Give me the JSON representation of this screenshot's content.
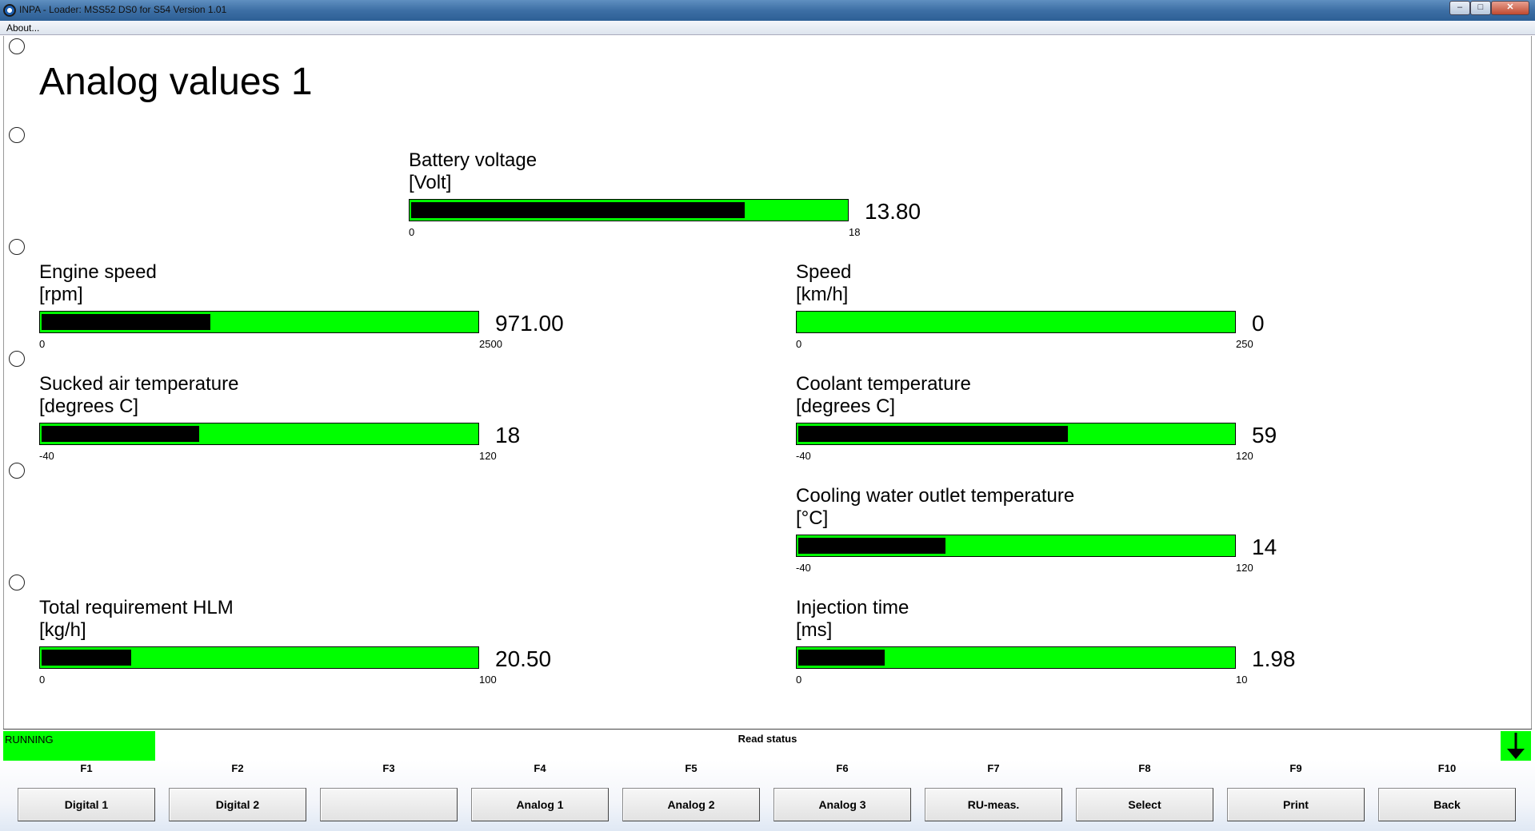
{
  "window": {
    "title": "INPA - Loader:  MSS52 DS0 for S54 Version 1.01",
    "min_glyph": "–",
    "max_glyph": "□",
    "close_glyph": "✕"
  },
  "menu": {
    "about": "About..."
  },
  "page_title": "Analog values 1",
  "colors": {
    "bar_background": "#00ff00",
    "bar_fill": "#000000",
    "status_running": "#00ff00"
  },
  "gauges": [
    {
      "label": "Battery voltage",
      "unit": "[Volt]",
      "value_text": "13.80",
      "value": 13.8,
      "min": "0",
      "max": "18",
      "min_num": 0,
      "max_num": 18
    },
    {
      "label": "Engine speed",
      "unit": "[rpm]",
      "value_text": "971.00",
      "value": 971,
      "min": "0",
      "max": "2500",
      "min_num": 0,
      "max_num": 2500
    },
    {
      "label": "Speed",
      "unit": "[km/h]",
      "value_text": "0",
      "value": 0,
      "min": "0",
      "max": "250",
      "min_num": 0,
      "max_num": 250
    },
    {
      "label": "Sucked air temperature",
      "unit": "[degrees C]",
      "value_text": "18",
      "value": 18,
      "min": "-40",
      "max": "120",
      "min_num": -40,
      "max_num": 120
    },
    {
      "label": "Coolant temperature",
      "unit": "[degrees C]",
      "value_text": "59",
      "value": 59,
      "min": "-40",
      "max": "120",
      "min_num": -40,
      "max_num": 120
    },
    {
      "label": "Cooling water outlet temperature",
      "unit": "[°C]",
      "value_text": "14",
      "value": 14,
      "min": "-40",
      "max": "120",
      "min_num": -40,
      "max_num": 120
    },
    {
      "label": "Total requirement HLM",
      "unit": "[kg/h]",
      "value_text": "20.50",
      "value": 20.5,
      "min": "0",
      "max": "100",
      "min_num": 0,
      "max_num": 100
    },
    {
      "label": "Injection time",
      "unit": "[ms]",
      "value_text": "1.98",
      "value": 1.98,
      "min": "0",
      "max": "10",
      "min_num": 0,
      "max_num": 10
    }
  ],
  "status": {
    "state": "RUNNING",
    "message": "Read status"
  },
  "fkeys": [
    {
      "key": "F1",
      "label": "Digital 1"
    },
    {
      "key": "F2",
      "label": "Digital 2"
    },
    {
      "key": "F3",
      "label": ""
    },
    {
      "key": "F4",
      "label": "Analog 1"
    },
    {
      "key": "F5",
      "label": "Analog 2"
    },
    {
      "key": "F6",
      "label": "Analog 3"
    },
    {
      "key": "F7",
      "label": "RU-meas."
    },
    {
      "key": "F8",
      "label": "Select"
    },
    {
      "key": "F9",
      "label": "Print"
    },
    {
      "key": "F10",
      "label": "Back"
    }
  ]
}
